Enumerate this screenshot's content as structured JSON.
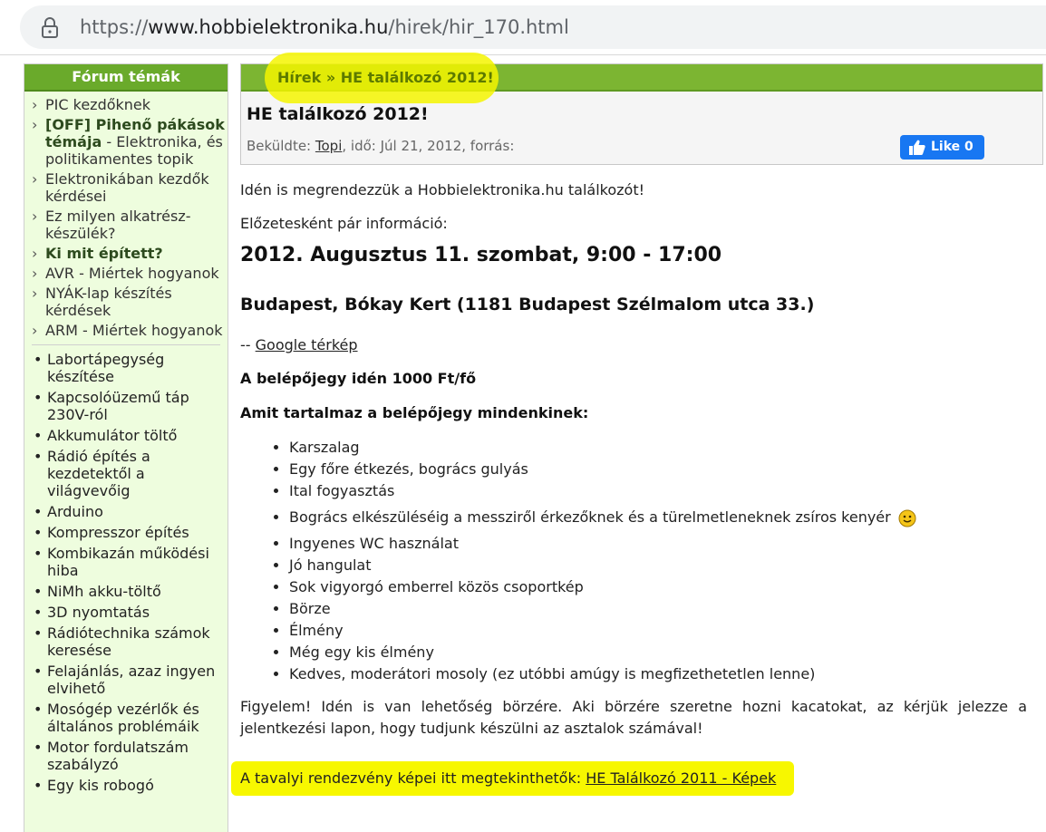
{
  "browser": {
    "url_scheme": "https://",
    "url_host": "www.hobbielektronika.hu",
    "url_path": "/hirek/hir_170.html"
  },
  "sidebar": {
    "title": "Fórum témák",
    "topics_primary": [
      {
        "label": "PIC kezdőknek",
        "bold": false
      },
      {
        "label": "[OFF] Pihenő pákások témája",
        "suffix": " - Elektronika, és politikamentes topik",
        "bold": true
      },
      {
        "label": "Elektronikában kezdők kérdései",
        "bold": false
      },
      {
        "label": "Ez milyen alkatrész-készülék?",
        "bold": false
      },
      {
        "label": "Ki mit épített?",
        "bold": true
      },
      {
        "label": "AVR - Miértek hogyanok",
        "bold": false
      },
      {
        "label": "NYÁK-lap készítés kérdések",
        "bold": false
      },
      {
        "label": "ARM - Miértek hogyanok",
        "bold": false
      }
    ],
    "topics_secondary": [
      "Labortápegység készítése",
      "Kapcsolóüzemű táp 230V-ról",
      "Akkumulátor töltő",
      "Rádió építés a kezdetektől a világvevőig",
      "Arduino",
      "Kompresszor építés",
      "Kombikazán működési hiba",
      "NiMh akku-töltő",
      "3D nyomtatás",
      "Rádiótechnika számok keresése",
      "Felajánlás, azaz ingyen elvihető",
      "Mosógép vezérlők és általános problémáik",
      "Motor fordulatszám szabályzó",
      "Egy kis robogó"
    ]
  },
  "article": {
    "breadcrumb_section": "Hírek",
    "breadcrumb_sep": " » ",
    "breadcrumb_current": "HE találkozó 2012!",
    "title": "HE találkozó 2012!",
    "meta_prefix": "Beküldte: ",
    "author": "Topi",
    "meta_suffix": ", idő: Júl 21, 2012, forrás:",
    "like_label": "Like",
    "like_count": "0",
    "p1": "Idén is megrendezzük a Hobbielektronika.hu találkozót!",
    "p2": "Előzetesként pár információ:",
    "date": "2012. Augusztus 11. szombat, 9:00 - 17:00",
    "venue": "Budapest, Bókay Kert (1181 Budapest Szélmalom utca 33.)",
    "map_prefix": "-- ",
    "map_link": "Google térkép",
    "ticket": "A belépőjegy idén 1000 Ft/fő",
    "includes_title": "Amit tartalmaz a belépőjegy mindenkinek:",
    "includes": [
      "Karszalag",
      "Egy főre étkezés, bogrács gulyás",
      "Ital fogyasztás",
      "Bogrács elkészüléséig a messziről érkezőknek és a türelmetleneknek zsíros kenyér",
      "Ingyenes WC használat",
      "Jó hangulat",
      "Sok vigyorgó emberrel közös csoportkép",
      "Börze",
      "Élmény",
      "Még egy kis élmény",
      "Kedves, moderátori mosoly (ez utóbbi amúgy is megfizethetetlen lenne)"
    ],
    "warning": "Figyelem! Idén is van lehetőség börzére. Aki börzére szeretne hozni kacatokat, az kérjük jelezze a jelentkezési lapon, hogy tudjunk készülni az asztalok számával!",
    "prev_text": "A tavalyi rendezvény képei itt megtekinthetők: ",
    "prev_link": "HE Találkozó 2011 - Képek"
  },
  "colors": {
    "header_green": "#6aaa2b",
    "sidebar_bg": "#eefdde",
    "highlight_yellow": "#f7f700",
    "facebook_blue": "#1877f2"
  }
}
